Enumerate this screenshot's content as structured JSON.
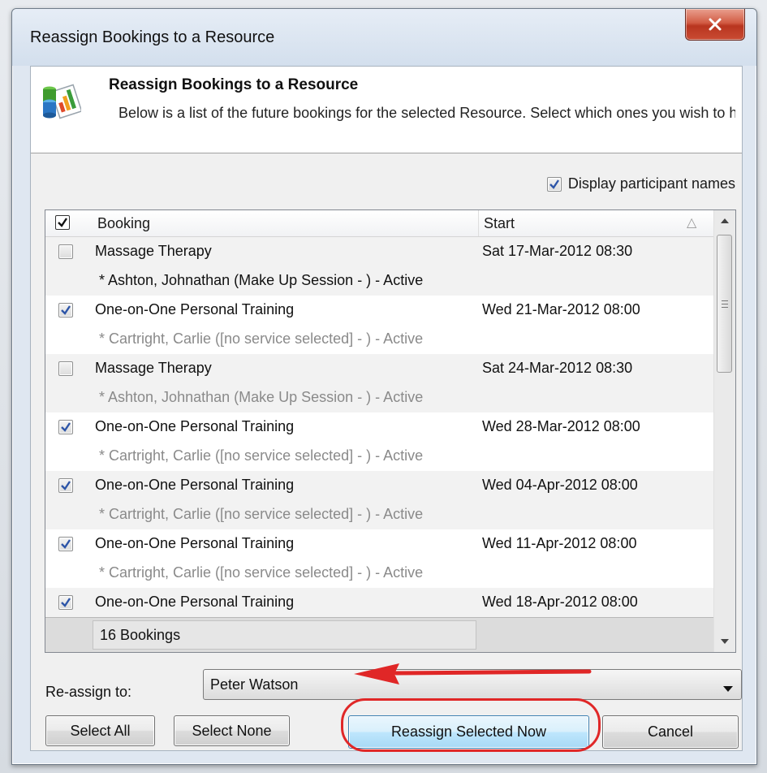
{
  "window": {
    "title": "Reassign Bookings to a Resource",
    "close_icon": "close-icon"
  },
  "header": {
    "icon": "resource-reassign-icon",
    "title": "Reassign Bookings to a Resource",
    "description": "Below is a list of the future bookings for the selected Resource.  Select which ones you wish to have reassigned and select the Resource you want them"
  },
  "options": {
    "display_names_label": "Display participant names",
    "display_names_checked": true
  },
  "grid": {
    "select_all_checked": true,
    "columns": {
      "booking": "Booking",
      "start": "Start"
    },
    "sort_icon": "sort-ascending-icon",
    "rows": [
      {
        "kind": "booking",
        "name": "Massage Therapy",
        "start": "Sat 17-Mar-2012 08:30",
        "checked": false
      },
      {
        "kind": "participant",
        "text": "* Ashton, Johnathan (Make Up Session - ) - Active"
      },
      {
        "kind": "booking",
        "name": "One-on-One Personal Training",
        "start": "Wed 21-Mar-2012 08:00",
        "checked": true
      },
      {
        "kind": "participant",
        "text": "* Cartright, Carlie ([no service selected] - ) - Active"
      },
      {
        "kind": "booking",
        "name": "Massage Therapy",
        "start": "Sat 24-Mar-2012 08:30",
        "checked": false
      },
      {
        "kind": "participant",
        "text": "* Ashton, Johnathan (Make Up Session - ) - Active"
      },
      {
        "kind": "booking",
        "name": "One-on-One Personal Training",
        "start": "Wed 28-Mar-2012 08:00",
        "checked": true
      },
      {
        "kind": "participant",
        "text": "* Cartright, Carlie ([no service selected] - ) - Active"
      },
      {
        "kind": "booking",
        "name": "One-on-One Personal Training",
        "start": "Wed 04-Apr-2012 08:00",
        "checked": true
      },
      {
        "kind": "participant",
        "text": "* Cartright, Carlie ([no service selected] - ) - Active"
      },
      {
        "kind": "booking",
        "name": "One-on-One Personal Training",
        "start": "Wed 11-Apr-2012 08:00",
        "checked": true
      },
      {
        "kind": "participant",
        "text": "* Cartright, Carlie ([no service selected] - ) - Active"
      },
      {
        "kind": "booking",
        "name": "One-on-One Personal Training",
        "start": "Wed 18-Apr-2012 08:00",
        "checked": true
      }
    ],
    "summary": "16 Bookings"
  },
  "reassign": {
    "label": "Re-assign to:",
    "selected": "Peter Watson"
  },
  "buttons": {
    "select_all": "Select All",
    "select_none": "Select None",
    "reassign_now": "Reassign Selected Now",
    "cancel": "Cancel"
  },
  "colors": {
    "annotation_red": "#e02727",
    "close_red": "#c94b33",
    "primary_button_blue": "#bee6fd"
  }
}
